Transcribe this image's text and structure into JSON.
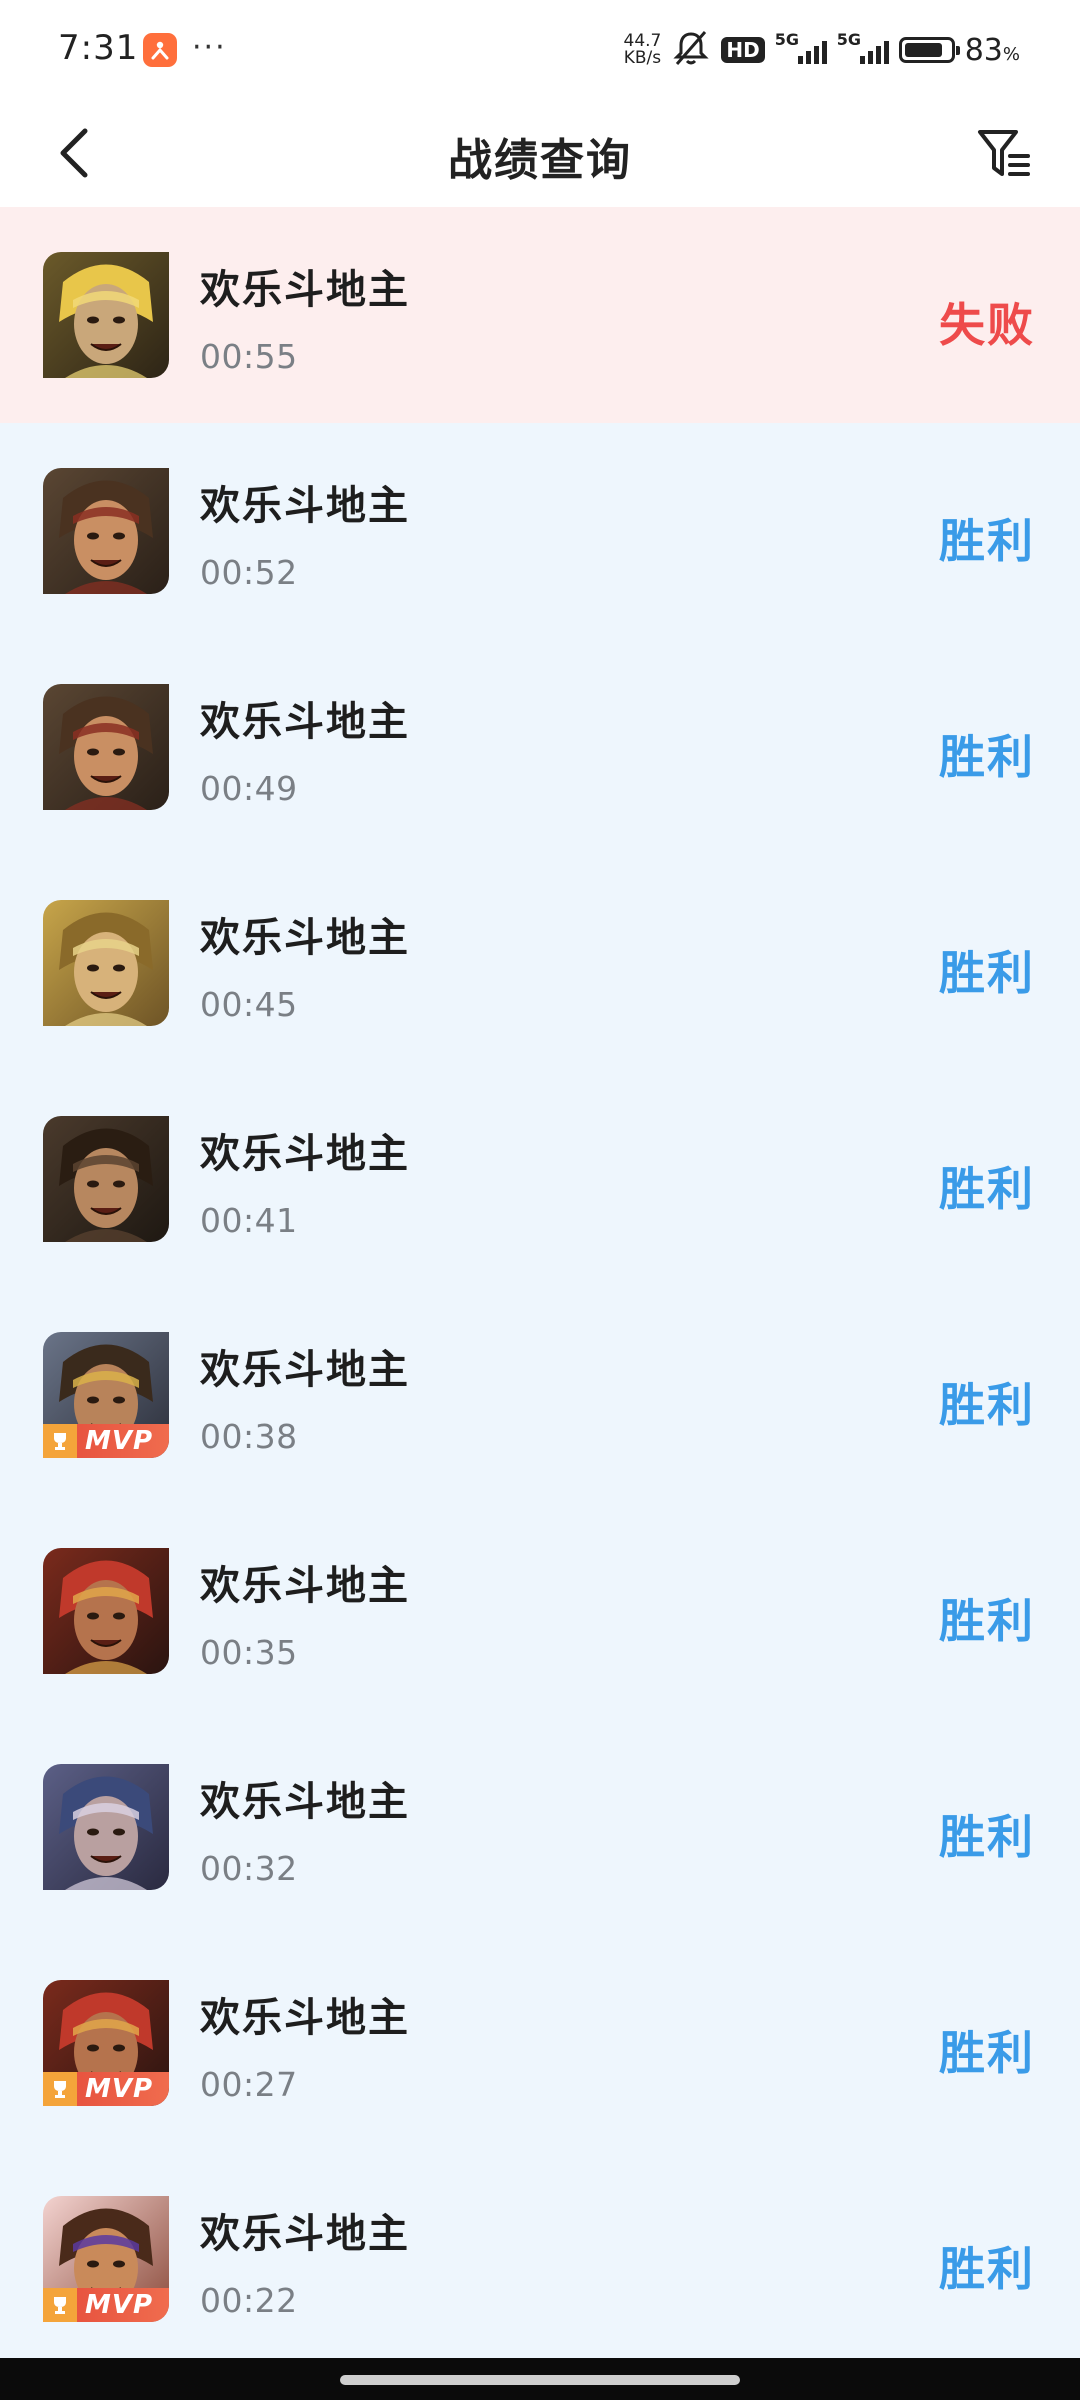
{
  "status_bar": {
    "time": "7:31",
    "more_dots": "···",
    "net_speed_value": "44.7",
    "net_speed_unit": "KB/s",
    "hd_label": "HD",
    "sim1_label": "5G",
    "sim2_label": "5G",
    "battery_percent": "83",
    "battery_unit": "%",
    "battery_level": 0.83
  },
  "header": {
    "title": "战绩查询",
    "back_icon": "chevron-left-icon",
    "filter_icon": "filter-icon"
  },
  "colors": {
    "win": "#3a9be8",
    "loss": "#ee4b4b",
    "loss_row_bg": "#fdeeee",
    "row_bg": "#eef6fd"
  },
  "mvp_label": "MVP",
  "matches": [
    {
      "game": "欢乐斗地主",
      "time": "00:55",
      "result": "失败",
      "outcome": "loss",
      "mvp": false,
      "avatar": "hero-gold-hair"
    },
    {
      "game": "欢乐斗地主",
      "time": "00:52",
      "result": "胜利",
      "outcome": "win",
      "mvp": false,
      "avatar": "hero-laughing-hat"
    },
    {
      "game": "欢乐斗地主",
      "time": "00:49",
      "result": "胜利",
      "outcome": "win",
      "mvp": false,
      "avatar": "hero-laughing-hat"
    },
    {
      "game": "欢乐斗地主",
      "time": "00:45",
      "result": "胜利",
      "outcome": "win",
      "mvp": false,
      "avatar": "hero-golden-duo"
    },
    {
      "game": "欢乐斗地主",
      "time": "00:41",
      "result": "胜利",
      "outcome": "win",
      "mvp": false,
      "avatar": "hero-long-hair"
    },
    {
      "game": "欢乐斗地主",
      "time": "00:38",
      "result": "胜利",
      "outcome": "win",
      "mvp": true,
      "avatar": "hero-helmet"
    },
    {
      "game": "欢乐斗地主",
      "time": "00:35",
      "result": "胜利",
      "outcome": "win",
      "mvp": false,
      "avatar": "hero-red-rage"
    },
    {
      "game": "欢乐斗地主",
      "time": "00:32",
      "result": "胜利",
      "outcome": "win",
      "mvp": false,
      "avatar": "hero-blue-elder"
    },
    {
      "game": "欢乐斗地主",
      "time": "00:27",
      "result": "胜利",
      "outcome": "win",
      "mvp": true,
      "avatar": "hero-red-rage"
    },
    {
      "game": "欢乐斗地主",
      "time": "00:22",
      "result": "胜利",
      "outcome": "win",
      "mvp": true,
      "avatar": "hero-warrior-headband"
    }
  ]
}
